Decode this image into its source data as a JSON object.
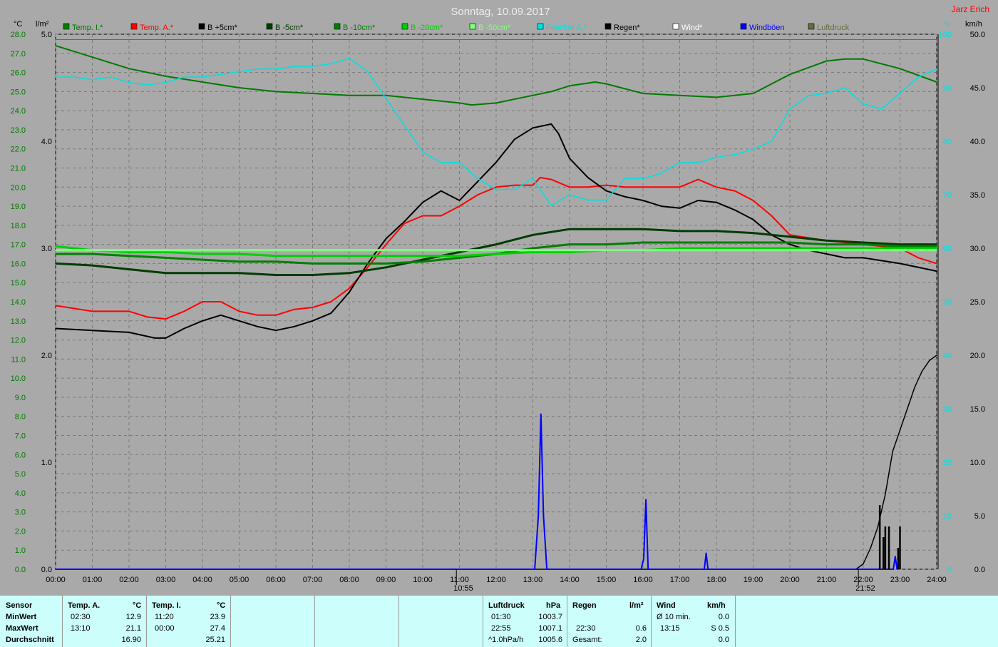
{
  "title": "Sonntag, 10.09.2017",
  "author": "Jarz Erich",
  "units": {
    "left": "°C",
    "left2": "l/m²",
    "right": "km/h",
    "right_small": "%"
  },
  "legend": [
    {
      "label": "Temp. I.*",
      "color": "#007a00"
    },
    {
      "label": "Temp. A.*",
      "color": "#ff0000"
    },
    {
      "label": "B +5cm*",
      "color": "#000000"
    },
    {
      "label": "B -5cm*",
      "color": "#003c00"
    },
    {
      "label": "B -10cm*",
      "color": "#008000"
    },
    {
      "label": "B -20cm*",
      "color": "#00d000"
    },
    {
      "label": "B -50cm*",
      "color": "#80ff80"
    },
    {
      "label": "Feuchte A.*",
      "color": "#00e0e0"
    },
    {
      "label": "Regen*",
      "color": "#000000"
    },
    {
      "label": "Wind*",
      "color": "#ffffff"
    },
    {
      "label": "Windböen",
      "color": "#0000ff"
    },
    {
      "label": "Luftdruck",
      "color": "#6b6b3a"
    }
  ],
  "markers": [
    {
      "time": "10:55",
      "hour": 10.917
    },
    {
      "time": "21:52",
      "hour": 21.867
    }
  ],
  "chart_data": {
    "type": "line",
    "x_ticks": [
      "00:00",
      "01:00",
      "02:00",
      "03:00",
      "04:00",
      "05:00",
      "06:00",
      "07:00",
      "08:00",
      "09:00",
      "10:00",
      "11:00",
      "12:00",
      "13:00",
      "14:00",
      "15:00",
      "16:00",
      "17:00",
      "18:00",
      "19:00",
      "20:00",
      "21:00",
      "22:00",
      "23:00",
      "24:00"
    ],
    "xlim": [
      0,
      24
    ],
    "temp_axis": {
      "ylim": [
        0,
        28
      ],
      "ticks": [
        "0.0",
        "1.0",
        "2.0",
        "3.0",
        "4.0",
        "5.0",
        "6.0",
        "7.0",
        "8.0",
        "9.0",
        "10.0",
        "11.0",
        "12.0",
        "13.0",
        "14.0",
        "15.0",
        "16.0",
        "17.0",
        "18.0",
        "19.0",
        "20.0",
        "21.0",
        "22.0",
        "23.0",
        "24.0",
        "25.0",
        "26.0",
        "27.0",
        "28.0"
      ]
    },
    "rain_axis": {
      "ylim": [
        0,
        5
      ],
      "ticks": [
        "0.0",
        "1.0",
        "2.0",
        "3.0",
        "4.0",
        "5.0"
      ]
    },
    "wind_axis": {
      "ylim": [
        0,
        50
      ],
      "ticks": [
        "0.0",
        "5.0",
        "10.0",
        "15.0",
        "20.0",
        "25.0",
        "30.0",
        "35.0",
        "40.0",
        "45.0",
        "50.0"
      ]
    },
    "humidity_axis": {
      "ylim": [
        0,
        100
      ],
      "ticks": [
        "0",
        "10",
        "20",
        "30",
        "40",
        "50",
        "60",
        "70",
        "80",
        "90",
        "100"
      ]
    },
    "series": [
      {
        "name": "Temp. I.*",
        "axis": "temp",
        "color": "#007a00",
        "width": 2,
        "x": [
          0,
          1,
          2,
          3,
          4,
          5,
          6,
          7,
          8,
          9,
          10,
          11,
          11.33,
          12,
          13,
          13.5,
          14,
          14.7,
          15,
          16,
          17,
          18,
          19,
          20,
          21,
          21.5,
          22,
          23,
          24
        ],
        "y": [
          27.4,
          26.8,
          26.2,
          25.8,
          25.5,
          25.2,
          25.0,
          24.9,
          24.8,
          24.8,
          24.6,
          24.4,
          24.3,
          24.4,
          24.8,
          25.0,
          25.3,
          25.5,
          25.4,
          24.9,
          24.8,
          24.7,
          24.9,
          25.9,
          26.6,
          26.7,
          26.7,
          26.2,
          25.5
        ]
      },
      {
        "name": "Temp. A.*",
        "axis": "temp",
        "color": "#ff0000",
        "width": 2,
        "x": [
          0,
          1,
          2,
          2.5,
          3,
          3.5,
          4,
          4.5,
          5,
          5.5,
          6,
          6.5,
          7,
          7.5,
          8,
          8.5,
          9,
          9.5,
          10,
          10.5,
          11,
          11.5,
          12,
          12.5,
          13,
          13.2,
          13.5,
          14,
          14.5,
          15,
          15.5,
          16,
          16.5,
          17,
          17.5,
          18,
          18.5,
          19,
          19.5,
          20,
          21,
          22,
          23,
          23.5,
          24
        ],
        "y": [
          13.8,
          13.5,
          13.5,
          13.2,
          13.1,
          13.5,
          14.0,
          14.0,
          13.5,
          13.3,
          13.3,
          13.6,
          13.7,
          14.0,
          14.7,
          15.8,
          17.0,
          18.1,
          18.5,
          18.5,
          19.0,
          19.6,
          20.0,
          20.1,
          20.1,
          20.5,
          20.4,
          20.0,
          20.0,
          20.1,
          20.0,
          20.0,
          20.0,
          20.0,
          20.4,
          20.0,
          19.8,
          19.3,
          18.5,
          17.5,
          17.2,
          17.0,
          16.8,
          16.3,
          16.0
        ]
      },
      {
        "name": "B +5cm*",
        "axis": "temp",
        "color": "#000000",
        "width": 2,
        "x": [
          0,
          1,
          2,
          2.7,
          3,
          3.5,
          4,
          4.5,
          5,
          5.5,
          6,
          6.5,
          7,
          7.5,
          8,
          8.5,
          9,
          9.5,
          10,
          10.5,
          11,
          11.5,
          12,
          12.5,
          13,
          13.5,
          13.7,
          14,
          14.5,
          15,
          15.5,
          16,
          16.5,
          17,
          17.5,
          18,
          18.5,
          19,
          19.5,
          20,
          20.5,
          21,
          21.5,
          22,
          23,
          24
        ],
        "y": [
          12.6,
          12.5,
          12.4,
          12.1,
          12.1,
          12.6,
          13.0,
          13.3,
          13.0,
          12.7,
          12.5,
          12.7,
          13.0,
          13.4,
          14.5,
          16.0,
          17.3,
          18.2,
          19.2,
          19.8,
          19.3,
          20.3,
          21.3,
          22.5,
          23.1,
          23.3,
          22.8,
          21.5,
          20.5,
          19.8,
          19.5,
          19.3,
          19.0,
          18.9,
          19.3,
          19.2,
          18.8,
          18.3,
          17.5,
          17.0,
          16.7,
          16.5,
          16.3,
          16.3,
          16.0,
          15.6
        ]
      },
      {
        "name": "B -5cm*",
        "axis": "temp",
        "color": "#003c00",
        "width": 3,
        "x": [
          0,
          1,
          2,
          3,
          4,
          5,
          6,
          7,
          8,
          9,
          10,
          11,
          12,
          13,
          14,
          15,
          16,
          17,
          18,
          19,
          20,
          21,
          22,
          23,
          24
        ],
        "y": [
          16.0,
          15.9,
          15.7,
          15.5,
          15.5,
          15.5,
          15.4,
          15.4,
          15.5,
          15.8,
          16.2,
          16.6,
          17.0,
          17.5,
          17.8,
          17.8,
          17.8,
          17.7,
          17.7,
          17.6,
          17.4,
          17.2,
          17.1,
          17.0,
          17.0
        ]
      },
      {
        "name": "B -10cm*",
        "axis": "temp",
        "color": "#008000",
        "width": 3,
        "x": [
          0,
          1,
          2,
          3,
          4,
          5,
          6,
          7,
          8,
          9,
          10,
          11,
          12,
          13,
          14,
          15,
          16,
          17,
          18,
          19,
          20,
          21,
          22,
          23,
          24
        ],
        "y": [
          16.5,
          16.5,
          16.4,
          16.3,
          16.2,
          16.1,
          16.1,
          16.0,
          16.0,
          16.0,
          16.1,
          16.3,
          16.5,
          16.8,
          17.0,
          17.0,
          17.1,
          17.1,
          17.1,
          17.1,
          17.1,
          17.0,
          17.0,
          16.9,
          16.9
        ]
      },
      {
        "name": "B -20cm*",
        "axis": "temp",
        "color": "#00d000",
        "width": 3,
        "x": [
          0,
          1,
          2,
          3,
          4,
          5,
          6,
          7,
          8,
          9,
          10,
          11,
          12,
          13,
          14,
          15,
          16,
          17,
          18,
          19,
          20,
          21,
          22,
          23,
          24
        ],
        "y": [
          16.9,
          16.7,
          16.6,
          16.6,
          16.5,
          16.5,
          16.4,
          16.4,
          16.4,
          16.4,
          16.4,
          16.4,
          16.5,
          16.6,
          16.6,
          16.7,
          16.7,
          16.8,
          16.8,
          16.8,
          16.8,
          16.8,
          16.8,
          16.8,
          16.8
        ]
      },
      {
        "name": "B -50cm*",
        "axis": "temp",
        "color": "#80ff80",
        "width": 3,
        "x": [
          0,
          24
        ],
        "y": [
          16.7,
          16.7
        ]
      },
      {
        "name": "Feuchte A.*",
        "axis": "humidity",
        "color": "#00e0e0",
        "width": 1.5,
        "x": [
          0,
          0.5,
          1,
          1.5,
          2,
          2.5,
          3,
          3.5,
          4,
          4.5,
          5,
          5.5,
          6,
          6.5,
          7,
          7.5,
          8,
          8.5,
          9,
          9.5,
          10,
          10.5,
          11,
          11.5,
          12,
          12.5,
          13,
          13.5,
          14,
          14.5,
          15,
          15.5,
          16,
          16.5,
          17,
          17.5,
          18,
          18.5,
          19,
          19.5,
          20,
          20.5,
          21,
          21.5,
          22,
          22.5,
          23,
          23.5,
          24
        ],
        "y": [
          92,
          92,
          91.5,
          92,
          91,
          90.5,
          91,
          92,
          92,
          92.5,
          93,
          93.5,
          93.5,
          94,
          94,
          94.5,
          95.5,
          93,
          88,
          83,
          78,
          76,
          76,
          73,
          71,
          71,
          73,
          68,
          70,
          69,
          69,
          73,
          73,
          74,
          76,
          76,
          77,
          77.5,
          78.5,
          80,
          86,
          88.5,
          89,
          90,
          87,
          86,
          89,
          92,
          93.5
        ]
      },
      {
        "name": "Regen*",
        "axis": "rain",
        "color": "#000000",
        "width": 1.5,
        "x": [
          0,
          21.8,
          22.0,
          22.2,
          22.4,
          22.6,
          22.8,
          23.0,
          23.2,
          23.4,
          23.6,
          23.8,
          24
        ],
        "y": [
          0,
          0,
          0.05,
          0.2,
          0.4,
          0.7,
          1.1,
          1.3,
          1.5,
          1.7,
          1.85,
          1.95,
          2.0
        ]
      },
      {
        "name": "Windböen",
        "axis": "wind",
        "color": "#0000ff",
        "width": 2,
        "x": [
          0,
          13.05,
          13.15,
          13.22,
          13.29,
          13.38,
          15.95,
          16.02,
          16.08,
          16.14,
          17.6,
          17.67,
          17.72,
          17.77,
          22.75,
          22.82,
          22.87,
          22.92
        ],
        "y": [
          0,
          0,
          5.0,
          14.5,
          5.0,
          0,
          0,
          1.0,
          6.5,
          0,
          0,
          0,
          1.5,
          0,
          0,
          0,
          1.2,
          0
        ]
      },
      {
        "name": "Luftdruck",
        "axis": "pressure",
        "color": "#6b6b3a",
        "width": 1,
        "x": [
          0,
          24
        ],
        "y": [
          49.5,
          49.5
        ]
      }
    ],
    "rain_bars": {
      "color": "#000000",
      "x": [
        22.45,
        22.55,
        22.6,
        22.7,
        22.95,
        23.0
      ],
      "y": [
        0.6,
        0.3,
        0.4,
        0.4,
        0.2,
        0.4
      ]
    }
  },
  "table": {
    "rows": [
      "Sensor",
      "MinWert",
      "MaxWert",
      "Durchschnitt"
    ],
    "temp_a": {
      "head": "Temp. A.",
      "unit": "°C",
      "min_time": "02:30",
      "min": "12.9",
      "max_time": "13:10",
      "max": "21.1",
      "avg": "16.90"
    },
    "temp_i": {
      "head": "Temp. I.",
      "unit": "°C",
      "min_time": "11:20",
      "min": "23.9",
      "max_time": "00:00",
      "max": "27.4",
      "avg": "25.21"
    },
    "pressure": {
      "head": "Luftdruck",
      "unit": "hPa",
      "min_time": "01:30",
      "min": "1003.7",
      "max_time": "22:55",
      "max": "1007.1",
      "avg_label": "^1.0hPa/h",
      "avg": "1005.6"
    },
    "rain": {
      "head": "Regen",
      "unit": "l/m²",
      "max_time": "22:30",
      "max": "0.6",
      "total_label": "Gesamt:",
      "total": "2.0"
    },
    "wind": {
      "head": "Wind",
      "unit": "km/h",
      "row1_label": "Ø 10 min.",
      "row1": "0.0",
      "row2_time": "13:15",
      "row2": "S 0.5",
      "row3": "0.0"
    }
  }
}
